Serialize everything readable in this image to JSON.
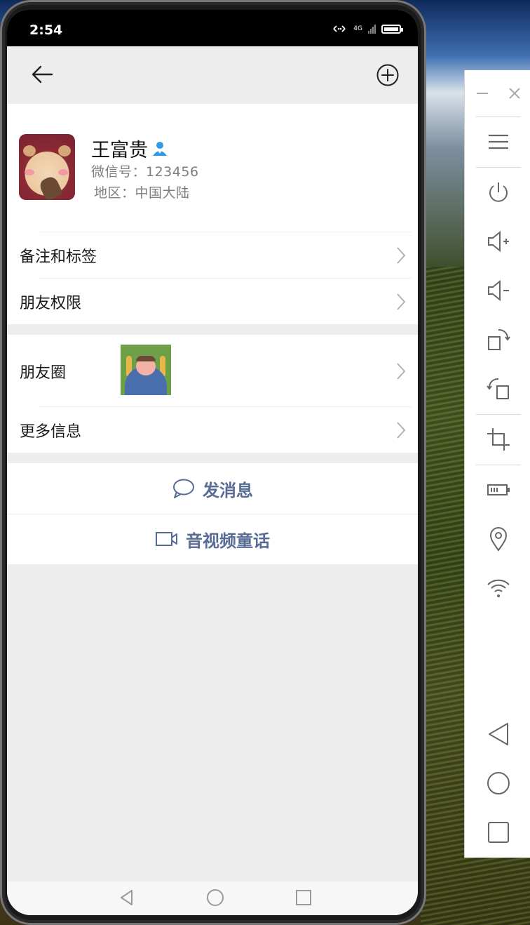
{
  "statusbar": {
    "time": "2:54",
    "network": "4G"
  },
  "navbar": {
    "back_icon": "arrow-left-icon",
    "add_icon": "plus-circle-icon"
  },
  "profile": {
    "name": "王富贵",
    "wechat_id": "微信号：123456",
    "region": "地区：中国大陆"
  },
  "cells_group1": [
    {
      "label": "备注和标签"
    },
    {
      "label": "朋友权限"
    }
  ],
  "cells_group2": [
    {
      "label": "朋友圈"
    },
    {
      "label": "更多信息"
    }
  ],
  "actions": {
    "message": "发消息",
    "video_call": "音视频童话"
  },
  "colors": {
    "link": "#576b95",
    "verify": "#2f9ae6",
    "background": "#ededed"
  },
  "toolbar_icons": [
    "minimize-icon",
    "close-icon",
    "menu-icon",
    "power-icon",
    "volume-up-icon",
    "volume-down-icon",
    "rotate-right-icon",
    "rotate-left-icon",
    "crop-icon",
    "battery-icon",
    "location-pin-icon",
    "wifi-icon",
    "back-triangle-icon",
    "home-circle-icon",
    "recent-square-icon"
  ]
}
